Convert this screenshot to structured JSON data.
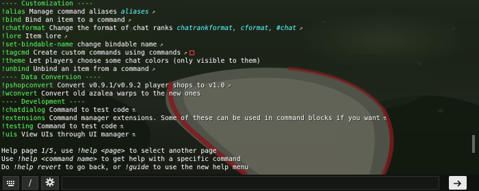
{
  "chat": {
    "lines": [
      {
        "type": "header",
        "text": "---- Customization ----"
      },
      {
        "cmd": "!alias",
        "desc": "Manage command aliases",
        "aqua": "aliases",
        "mark": "↗"
      },
      {
        "cmd": "!bind",
        "desc": "Bind an item to a command",
        "mark": "↗"
      },
      {
        "cmd": "!chatformat",
        "desc": "Change the format of chat ranks",
        "aqua": "chatrankformat, cformat, #chat",
        "mark": "↗"
      },
      {
        "cmd": "!lore",
        "desc": "Item lore",
        "mark": "↗"
      },
      {
        "cmd": "!set-bindable-name",
        "desc": "change bindable name",
        "mark": "↗"
      },
      {
        "cmd": "!tagcmd",
        "desc": "Create custom commands using commands",
        "mark": "↗",
        "redbox": true
      },
      {
        "cmd": "!theme",
        "desc": "Let players choose some chat colors (only visible to them)"
      },
      {
        "cmd": "!unbind",
        "desc": "Unbind an item from a command",
        "mark": "↗"
      },
      {
        "type": "header",
        "text": "---- Data Conversion ----"
      },
      {
        "cmd": "!pshopconvert",
        "desc": "Convert v0.9.1/v0.9.2 player shops to v1.0",
        "mark": "↗"
      },
      {
        "cmd": "!wconvert",
        "desc": "Convert old azalea warps to the new ones"
      },
      {
        "type": "header",
        "text": "---- Development ----"
      },
      {
        "cmd": "!chatdialog",
        "desc": "Command to test code",
        "mark": "⚗"
      },
      {
        "cmd": "!extensions",
        "desc": "Command manager extensions. Some of these can be used in command blocks if you want",
        "mark": "⚗"
      },
      {
        "cmd": "!testing",
        "desc": "Command to test code",
        "mark": "⚗"
      },
      {
        "cmd": "!uis",
        "desc": "View UIs through UI manager",
        "mark": "⚗"
      },
      {
        "type": "blank"
      },
      {
        "type": "help1",
        "a": "Help page ",
        "b": "1/5",
        "c": ", use ",
        "d": "!help <page>",
        "e": " to select another page"
      },
      {
        "type": "help2",
        "a": "Use ",
        "b": "!help <command name>",
        "c": " to get help with a specific command"
      },
      {
        "type": "help3",
        "a": "Do ",
        "b": "!help revert",
        "c": " to go back, or ",
        "d": "!guide",
        "e": " to use the new help menu"
      }
    ]
  },
  "input_bar": {
    "menu_icon": "keyboard-icon",
    "slash_label": "/",
    "settings_icon": "gear-icon",
    "input_value": "",
    "send_icon": "arrow-right-icon"
  }
}
